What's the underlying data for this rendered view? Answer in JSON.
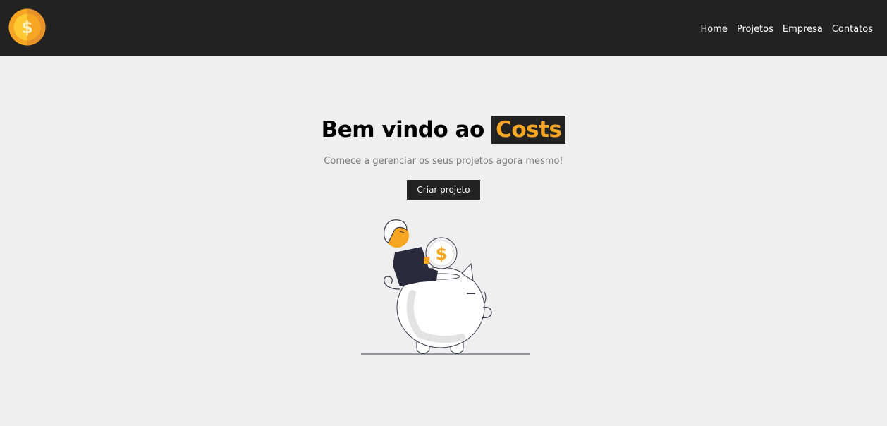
{
  "navbar": {
    "logo_icon": "dollar-coin-icon",
    "links": [
      "Home",
      "Projetos",
      "Empresa",
      "Contatos"
    ]
  },
  "hero": {
    "title_prefix": "Bem vindo ao",
    "title_brand": "Costs",
    "subtitle": "Comece a gerenciar os seus projetos agora mesmo!",
    "cta_label": "Criar projeto",
    "illustration": "savings-piggy-bank-illustration"
  },
  "colors": {
    "navbar_bg": "#222222",
    "accent": "#f6a623",
    "page_bg": "#efefef"
  }
}
